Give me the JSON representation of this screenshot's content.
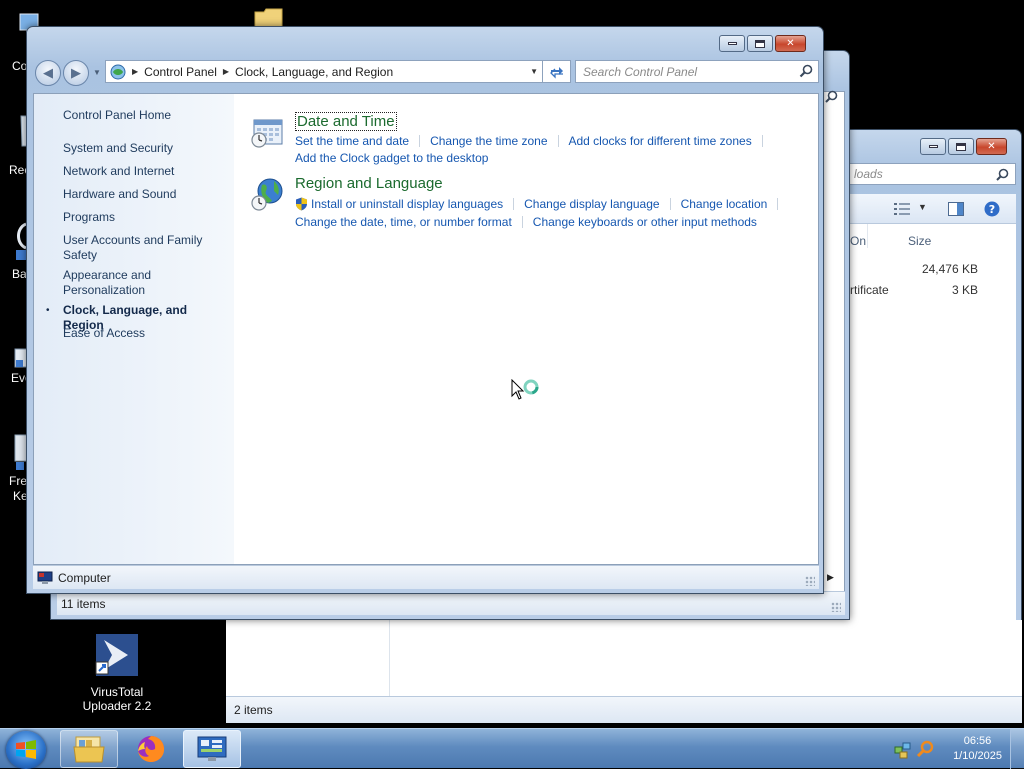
{
  "desktop": {
    "stubs": {
      "computer": "Co",
      "recycle": "Rec",
      "backup": "Ba",
      "event": "Eve",
      "free_l1": "Fre",
      "free_l2": "Ke"
    },
    "virustotal_l1": "VirusTotal",
    "virustotal_l2": "Uploader 2.2"
  },
  "explorer": {
    "address_fragment": "loads",
    "col_on": "On",
    "col_size": "Size",
    "rows": [
      {
        "name": "",
        "size": "24,476 KB"
      },
      {
        "name": "rtificate",
        "size": "3 KB"
      }
    ],
    "status": "2 items"
  },
  "cp_back": {
    "status": "11 items"
  },
  "control_panel": {
    "breadcrumb": [
      "Control Panel",
      "Clock, Language, and Region"
    ],
    "search_placeholder": "Search Control Panel",
    "left_nav": {
      "home": "Control Panel Home",
      "items": [
        {
          "l1": "System and Security",
          "l2": ""
        },
        {
          "l1": "Network and Internet",
          "l2": ""
        },
        {
          "l1": "Hardware and Sound",
          "l2": ""
        },
        {
          "l1": "Programs",
          "l2": ""
        },
        {
          "l1": "User Accounts and Family",
          "l2": "Safety"
        },
        {
          "l1": "Appearance and",
          "l2": "Personalization"
        },
        {
          "l1": "Clock, Language, and Region",
          "l2": ""
        },
        {
          "l1": "Ease of Access",
          "l2": ""
        }
      ],
      "bullet": "•"
    },
    "categories": [
      {
        "title": "Date and Time",
        "tasks_row1": [
          "Set the time and date",
          "Change the time zone",
          "Add clocks for different time zones"
        ],
        "tasks_row2": [
          "Add the Clock gadget to the desktop"
        ]
      },
      {
        "title": "Region and Language",
        "tasks_row1": [
          "Install or uninstall display languages",
          "Change display language",
          "Change location"
        ],
        "tasks_row2": [
          "Change the date, time, or number format",
          "Change keyboards or other input methods"
        ]
      }
    ],
    "status": "Computer"
  },
  "taskbar": {
    "time": "06:56",
    "date": "1/10/2025"
  },
  "colors": {
    "link": "#1657b0",
    "category_title": "#1b6a2e",
    "taskbar": "#5f8bbf"
  }
}
